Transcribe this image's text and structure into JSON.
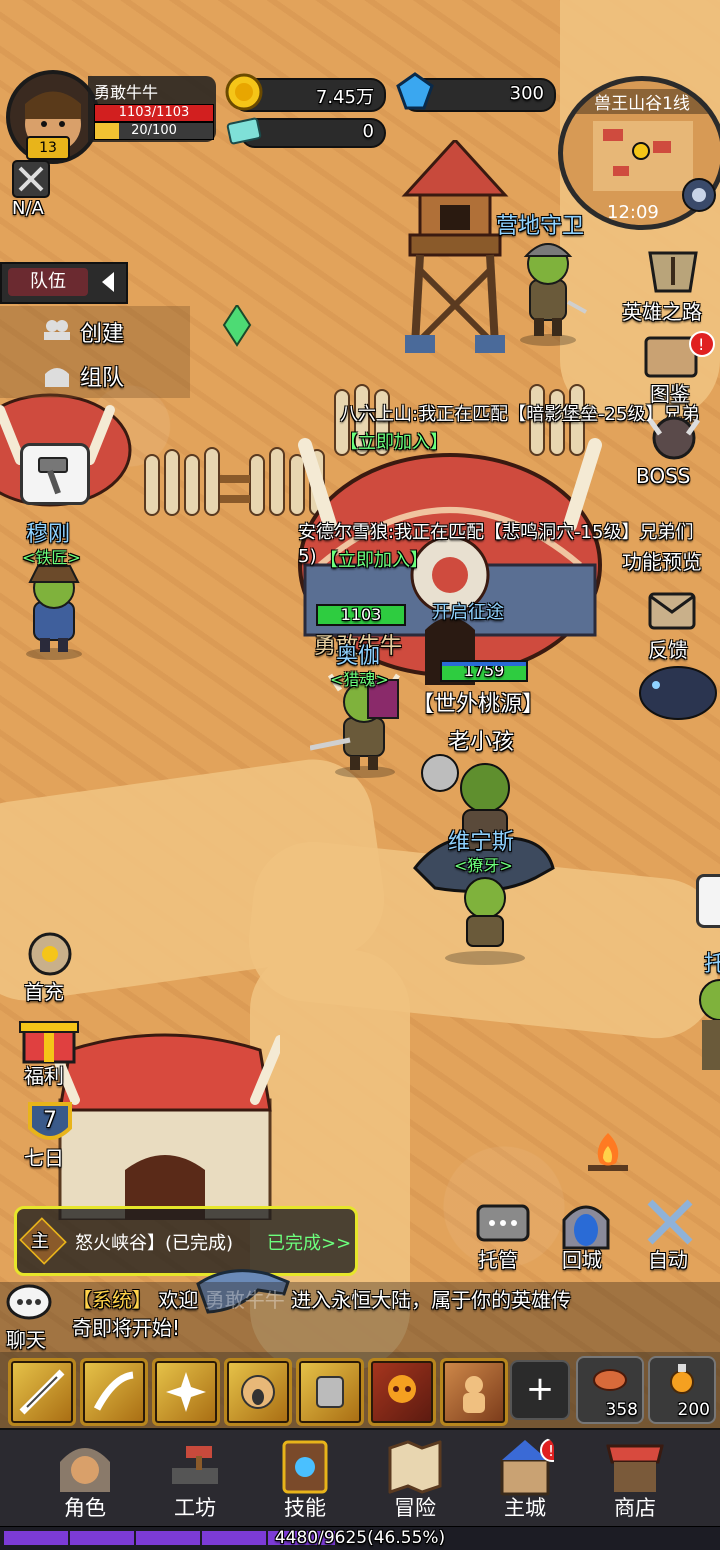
{
  "player": {
    "name": "勇敢牛牛",
    "hp": "1103/1103",
    "energy": "20/100",
    "level": "13",
    "pvp_status": "N/A"
  },
  "currency": {
    "gold": "7.45万",
    "gems": "300",
    "tickets": "0"
  },
  "minimap": {
    "area": "兽王山谷1线",
    "time": "12:09"
  },
  "team_panel": {
    "title": "队伍",
    "create": "创建",
    "join": "组队"
  },
  "right_menu": {
    "hero_road": "英雄之路",
    "codex": "图鉴",
    "boss": "BOSS",
    "preview": "功能预览",
    "feedback": "反馈"
  },
  "left_menu": {
    "first_charge": "首充",
    "welfare": "福利",
    "seven_day": "七日",
    "seven_day_num": "7"
  },
  "world": {
    "camp_guard": "营地守卫",
    "chat1": "八六上山:我正在匹配【暗影堡垒-25级】兄弟",
    "chat1_join": "【立即加入】",
    "chat2": "安德尔雪狼:我正在匹配【悲鸣洞穴-15级】兄弟们",
    "chat2_suffix": "5)",
    "chat2_join": "【立即加入】",
    "npc_smith_name": "穆刚",
    "npc_smith_title": "<铁匠>",
    "player_hp_tag": "1103",
    "player_name_overlap": "勇敢牛牛",
    "npc_hunter_name": "奥伽",
    "npc_hunter_title": "<猎魂>",
    "expedition": "开启征途",
    "enemy_hp_tag": "1759",
    "guild_name": "【世外桃源】",
    "other_player": "老小孩",
    "npc_wolf_name": "维宁斯",
    "npc_wolf_title": "<獠牙>",
    "edge_name": "托"
  },
  "quest": {
    "tag": "主",
    "text": "怒火峡谷】(已完成)",
    "action": "已完成>>"
  },
  "actions": {
    "auto_manage": "托管",
    "return_city": "回城",
    "auto": "自动"
  },
  "chat": {
    "label": "聊天",
    "channel": "【系统】",
    "msg_a": "欢迎",
    "msg_name": "勇敢牛牛",
    "msg_b": "进入永恒大陆，属于你的英雄传",
    "msg_c": "奇即将开始!"
  },
  "skills": [
    "slash-skill",
    "blade-skill",
    "burst-skill",
    "roar-skill",
    "shield-skill",
    "skull-skill",
    "rage-skill"
  ],
  "consumables": {
    "add": "+",
    "meat_count": "358",
    "potion_count": "200"
  },
  "bottom_nav": {
    "role": "角色",
    "workshop": "工坊",
    "skills": "技能",
    "adventure": "冒险",
    "main_city": "主城",
    "shop": "商店"
  },
  "xp": {
    "text": "4480/9625(46.55%)",
    "fraction": 0.4655
  },
  "colors": {
    "hp": "#d21f1f",
    "energy": "#f1c232",
    "xp": "#7c3bd6",
    "name_blue": "#8fd2ff",
    "title_green": "#6cff7d",
    "quest_border": "#e6e62a"
  }
}
